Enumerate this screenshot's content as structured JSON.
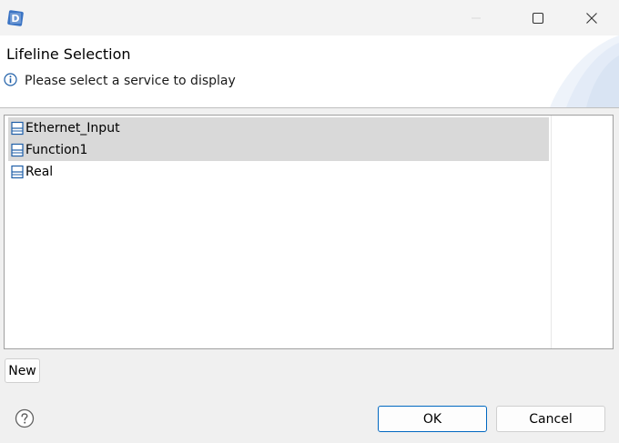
{
  "window": {
    "app_icon": "d-logo-icon",
    "controls": [
      "minimize-icon",
      "maximize-icon",
      "close-icon"
    ]
  },
  "header": {
    "title": "Lifeline Selection",
    "message": "Please select a service to display",
    "message_icon": "info-icon"
  },
  "services": {
    "items": [
      {
        "label": "Ethernet_Input",
        "selected": true,
        "icon": "lifeline-icon"
      },
      {
        "label": "Function1",
        "selected": true,
        "icon": "lifeline-icon"
      },
      {
        "label": "Real",
        "selected": false,
        "icon": "lifeline-icon"
      }
    ]
  },
  "actions": {
    "new_label": "New",
    "ok_label": "OK",
    "cancel_label": "Cancel",
    "help_icon": "help-icon"
  },
  "colors": {
    "selection": "#d9d9d9",
    "accent": "#0067c0",
    "icon_blue": "#1f5fa8"
  }
}
